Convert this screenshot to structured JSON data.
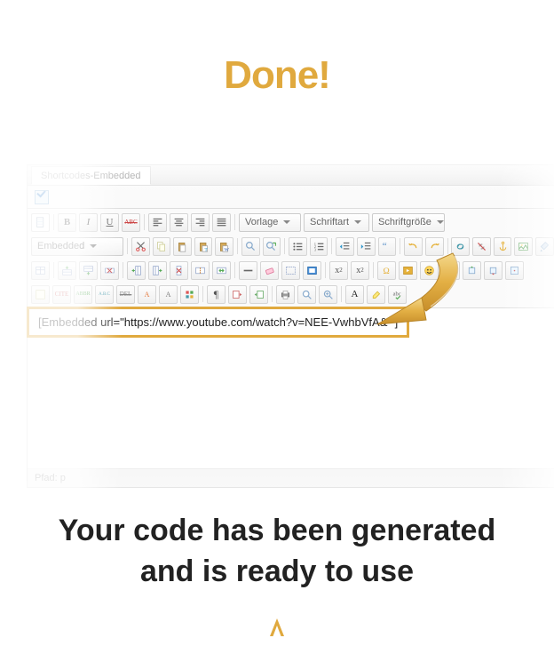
{
  "heading": "Done!",
  "subheading_line1": "Your code has been generated",
  "subheading_line2": "and is ready to use",
  "tab_label": "Shortcodes-Embedded",
  "selects": {
    "template": "Vorlage",
    "font_family": "Schriftart",
    "font_size": "Schriftgröße",
    "embedded": "Embedded"
  },
  "shortcode": "[Embedded url=\"https://www.youtube.com/watch?v=NEE-VwhbVfA&\" ]",
  "path": "Pfad: p",
  "toolbar": {
    "bold": "B",
    "italic": "I",
    "underline": "U",
    "strike": "ABC"
  },
  "colors": {
    "accent": "#e0a93e"
  }
}
